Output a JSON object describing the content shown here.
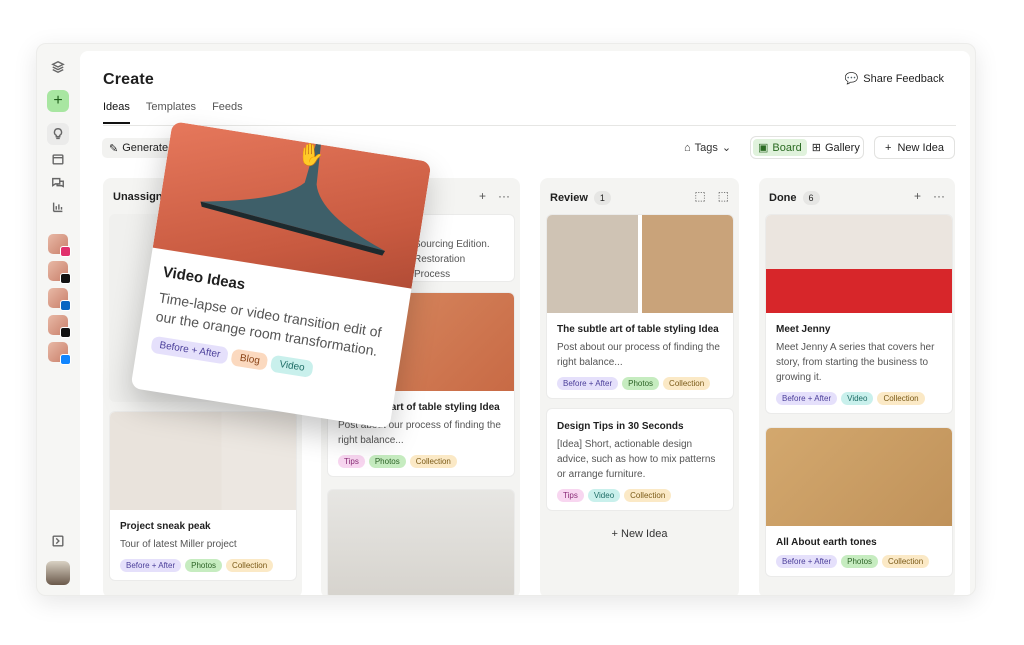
{
  "page": {
    "title": "Create",
    "share_label": "Share Feedback"
  },
  "tabs": [
    {
      "label": "Ideas"
    },
    {
      "label": "Templates"
    },
    {
      "label": "Feeds"
    }
  ],
  "toolbar": {
    "generate_label": "Generate Idea",
    "tags_label": "Tags",
    "board_label": "Board",
    "gallery_label": "Gallery",
    "new_idea_label": "New Idea"
  },
  "columns": {
    "unassigned": {
      "title": "Unassigned"
    },
    "review": {
      "title": "Review",
      "count": "1"
    },
    "done": {
      "title": "Done",
      "count": "6"
    }
  },
  "cards": {
    "project": {
      "title": "Project sneak peak",
      "body": "Tour of latest Miller project",
      "tags": [
        "Before + After",
        "Photos",
        "Collection"
      ]
    },
    "sourcing": {
      "body": "Sourcing Edition. Restoration Process"
    },
    "table_art": {
      "title": "The subtle art of table styling Idea",
      "body": "Post about our process of finding the right balance...",
      "tags": [
        "Tips",
        "Photos",
        "Collection"
      ]
    },
    "review_table": {
      "title": "The subtle art of table styling Idea",
      "body": "Post about our process of finding the right balance...",
      "tags": [
        "Before + After",
        "Photos",
        "Collection"
      ]
    },
    "design_tips": {
      "title": "Design Tips in 30 Seconds",
      "body": "[Idea] Short, actionable design advice, such as how to mix patterns or arrange furniture.",
      "tags": [
        "Tips",
        "Video",
        "Collection"
      ]
    },
    "review_new": "New Idea",
    "jenny": {
      "title": "Meet Jenny",
      "body": "Meet Jenny A series that covers her story, from starting the business to growing it.",
      "tags": [
        "Before + After",
        "Video",
        "Collection"
      ]
    },
    "earth": {
      "title": "All About earth tones",
      "tags": [
        "Before + After",
        "Photos",
        "Collection"
      ]
    }
  },
  "dragged_card": {
    "title": "Video Ideas",
    "body": "Time-lapse or video transition edit of our the orange room transformation.",
    "tags": [
      "Before + After",
      "Blog",
      "Video"
    ]
  },
  "colors": {
    "accent_green": "#a8e6a1",
    "board_active": "#e0f2dc"
  }
}
